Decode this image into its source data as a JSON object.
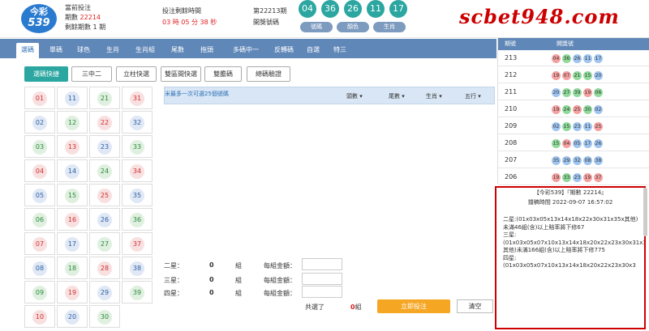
{
  "site_watermark": "scbet948.com",
  "logo": {
    "line1": "今彩",
    "line2": "539"
  },
  "current": {
    "label": "當前投注",
    "period_label": "期數",
    "period": "22214",
    "left_label": "剩餘期數",
    "left_value": "1",
    "left_unit": "期"
  },
  "countdown": {
    "label": "投注剩餘時間",
    "time": "03 時 05 分 38 秒"
  },
  "last_draw": {
    "label": "第22213期",
    "sub": "開獎號碼",
    "numbers": [
      "04",
      "36",
      "26",
      "11",
      "17"
    ],
    "buttons": [
      "號碼",
      "顏色",
      "生肖"
    ]
  },
  "nav_tabs": [
    "選碼",
    "單碼",
    "球色",
    "生肖",
    "生肖組",
    "尾數",
    "拖頭",
    "多碼中一",
    "反轉碼",
    "自選",
    "特三"
  ],
  "sub_buttons": [
    "選碼快捷",
    "三中二",
    "立柱快選",
    "雙區間快選",
    "雙膽碼",
    "總碼驗證"
  ],
  "numbers": [
    {
      "n": "01",
      "c": "red"
    },
    {
      "n": "11",
      "c": "blue"
    },
    {
      "n": "21",
      "c": "green"
    },
    {
      "n": "31",
      "c": "red"
    },
    {
      "n": "02",
      "c": "blue"
    },
    {
      "n": "12",
      "c": "green"
    },
    {
      "n": "22",
      "c": "red"
    },
    {
      "n": "32",
      "c": "blue"
    },
    {
      "n": "03",
      "c": "green"
    },
    {
      "n": "13",
      "c": "red"
    },
    {
      "n": "23",
      "c": "blue"
    },
    {
      "n": "33",
      "c": "green"
    },
    {
      "n": "04",
      "c": "red"
    },
    {
      "n": "14",
      "c": "blue"
    },
    {
      "n": "24",
      "c": "green"
    },
    {
      "n": "34",
      "c": "red"
    },
    {
      "n": "05",
      "c": "blue"
    },
    {
      "n": "15",
      "c": "green"
    },
    {
      "n": "25",
      "c": "red"
    },
    {
      "n": "35",
      "c": "blue"
    },
    {
      "n": "06",
      "c": "green"
    },
    {
      "n": "16",
      "c": "red"
    },
    {
      "n": "26",
      "c": "blue"
    },
    {
      "n": "36",
      "c": "green"
    },
    {
      "n": "07",
      "c": "red"
    },
    {
      "n": "17",
      "c": "blue"
    },
    {
      "n": "27",
      "c": "green"
    },
    {
      "n": "37",
      "c": "red"
    },
    {
      "n": "08",
      "c": "blue"
    },
    {
      "n": "18",
      "c": "green"
    },
    {
      "n": "28",
      "c": "red"
    },
    {
      "n": "38",
      "c": "blue"
    },
    {
      "n": "09",
      "c": "green"
    },
    {
      "n": "19",
      "c": "red"
    },
    {
      "n": "29",
      "c": "blue"
    },
    {
      "n": "39",
      "c": "green"
    },
    {
      "n": "10",
      "c": "red"
    },
    {
      "n": "20",
      "c": "blue"
    },
    {
      "n": "30",
      "c": "green"
    }
  ],
  "panel": {
    "hint": "米最多一次可選25個號碼",
    "cols": [
      "頭數",
      "尾數",
      "生肖",
      "五行"
    ]
  },
  "bets": [
    {
      "label": "二星：",
      "count": "0",
      "unit": "組",
      "amount_label": "每組金額："
    },
    {
      "label": "三星：",
      "count": "0",
      "unit": "組",
      "amount_label": "每組金額："
    },
    {
      "label": "四星：",
      "count": "0",
      "unit": "組",
      "amount_label": "每組金額："
    }
  ],
  "total": {
    "label": "共選了",
    "value": "0",
    "unit": "組"
  },
  "actions": {
    "submit": "立即投注",
    "clear": "清空"
  },
  "history": {
    "headers": [
      "期號",
      "開獎號"
    ],
    "rows": [
      {
        "p": "213",
        "b": [
          [
            "04",
            "red"
          ],
          [
            "36",
            "green"
          ],
          [
            "26",
            "blue"
          ],
          [
            "11",
            "blue"
          ],
          [
            "17",
            "blue"
          ]
        ]
      },
      {
        "p": "212",
        "b": [
          [
            "19",
            "red"
          ],
          [
            "07",
            "red"
          ],
          [
            "21",
            "green"
          ],
          [
            "15",
            "green"
          ],
          [
            "20",
            "blue"
          ]
        ]
      },
      {
        "p": "211",
        "b": [
          [
            "20",
            "blue"
          ],
          [
            "27",
            "green"
          ],
          [
            "39",
            "green"
          ],
          [
            "19",
            "red"
          ],
          [
            "06",
            "green"
          ]
        ]
      },
      {
        "p": "210",
        "b": [
          [
            "19",
            "red"
          ],
          [
            "24",
            "green"
          ],
          [
            "25",
            "red"
          ],
          [
            "30",
            "green"
          ],
          [
            "02",
            "blue"
          ]
        ]
      },
      {
        "p": "209",
        "b": [
          [
            "02",
            "blue"
          ],
          [
            "15",
            "green"
          ],
          [
            "23",
            "blue"
          ],
          [
            "11",
            "blue"
          ],
          [
            "25",
            "red"
          ]
        ]
      },
      {
        "p": "208",
        "b": [
          [
            "15",
            "green"
          ],
          [
            "04",
            "red"
          ],
          [
            "05",
            "blue"
          ],
          [
            "17",
            "blue"
          ],
          [
            "26",
            "blue"
          ]
        ]
      },
      {
        "p": "207",
        "b": [
          [
            "35",
            "blue"
          ],
          [
            "29",
            "blue"
          ],
          [
            "32",
            "blue"
          ],
          [
            "08",
            "blue"
          ],
          [
            "38",
            "blue"
          ]
        ]
      },
      {
        "p": "206",
        "b": [
          [
            "19",
            "red"
          ],
          [
            "33",
            "green"
          ],
          [
            "23",
            "blue"
          ],
          [
            "19",
            "red"
          ],
          [
            "37",
            "red"
          ]
        ]
      }
    ]
  },
  "popup": {
    "title": "【今彩539】『期數 22214』",
    "time": "擋稿時間 2022-09-07 16:57:02",
    "lines": [
      "二星:(01x03x05x13x14x18x22x30x31x35x其他)未滿46組(含)以上賠率將下修67",
      "三星:",
      "(01x03x05x07x10x13x14x18x20x22x23x30x31x32x33x35x39x其他)未滿166組(含)以上賠率將下修775",
      "四星:",
      "(01x03x05x07x10x13x14x18x20x22x23x30x3"
    ]
  }
}
